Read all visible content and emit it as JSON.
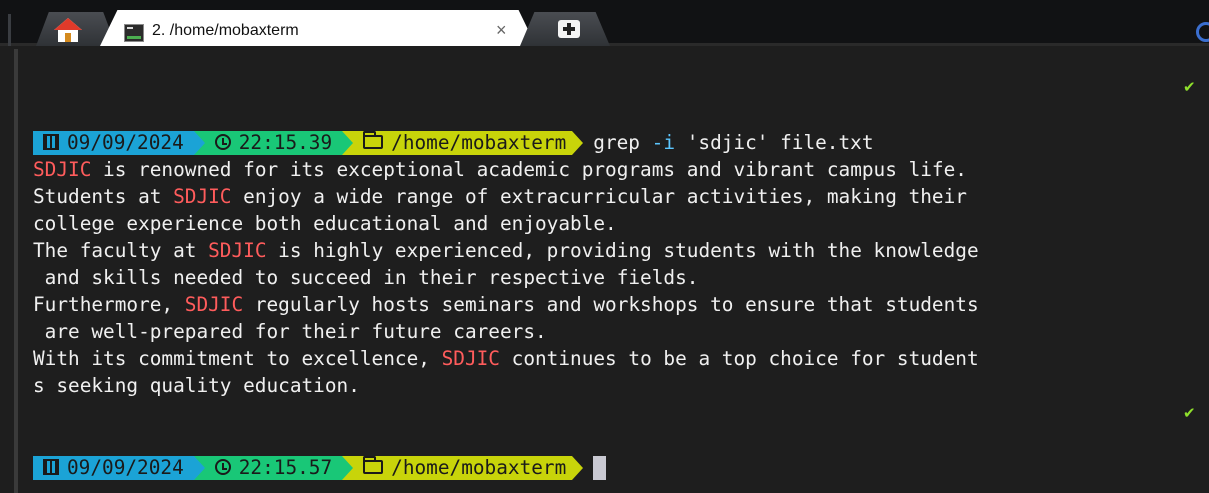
{
  "tabs": {
    "home_icon": "home-icon",
    "active_tab_title": "2. /home/mobaxterm",
    "close_label": "×",
    "new_tab_icon": "plus-icon"
  },
  "prompt1": {
    "date": "09/09/2024",
    "time": "22:15.39",
    "dir": "/home/mobaxterm",
    "cmd_name": "grep",
    "cmd_opt": "-i",
    "cmd_args": "'sdjic' file.txt"
  },
  "output": {
    "l1_a": "SDJIC",
    "l1_b": " is renowned for its exceptional academic programs and vibrant campus life.",
    "l2_a": "Students at ",
    "l2_b": "SDJIC",
    "l2_c": " enjoy a wide range of extracurricular activities, making their",
    "l3": "college experience both educational and enjoyable.",
    "l4_a": "The faculty at ",
    "l4_b": "SDJIC",
    "l4_c": " is highly experienced, providing students with the knowledge",
    "l5": " and skills needed to succeed in their respective fields.",
    "l6_a": "Furthermore, ",
    "l6_b": "SDJIC",
    "l6_c": " regularly hosts seminars and workshops to ensure that students",
    "l7": " are well-prepared for their future careers.",
    "l8_a": "With its commitment to excellence, ",
    "l8_b": "SDJIC",
    "l8_c": " continues to be a top choice for student",
    "l9": "s seeking quality education."
  },
  "prompt2": {
    "date": "09/09/2024",
    "time": "22:15.57",
    "dir": "/home/mobaxterm"
  },
  "status": {
    "check_mark": "✔"
  },
  "colors": {
    "date_segment": "#1ba3d6",
    "time_segment": "#19c777",
    "dir_segment": "#c8d40a",
    "match_highlight": "#ff5c5c",
    "option_color": "#5cc7ff",
    "check_color": "#8fe02c"
  }
}
